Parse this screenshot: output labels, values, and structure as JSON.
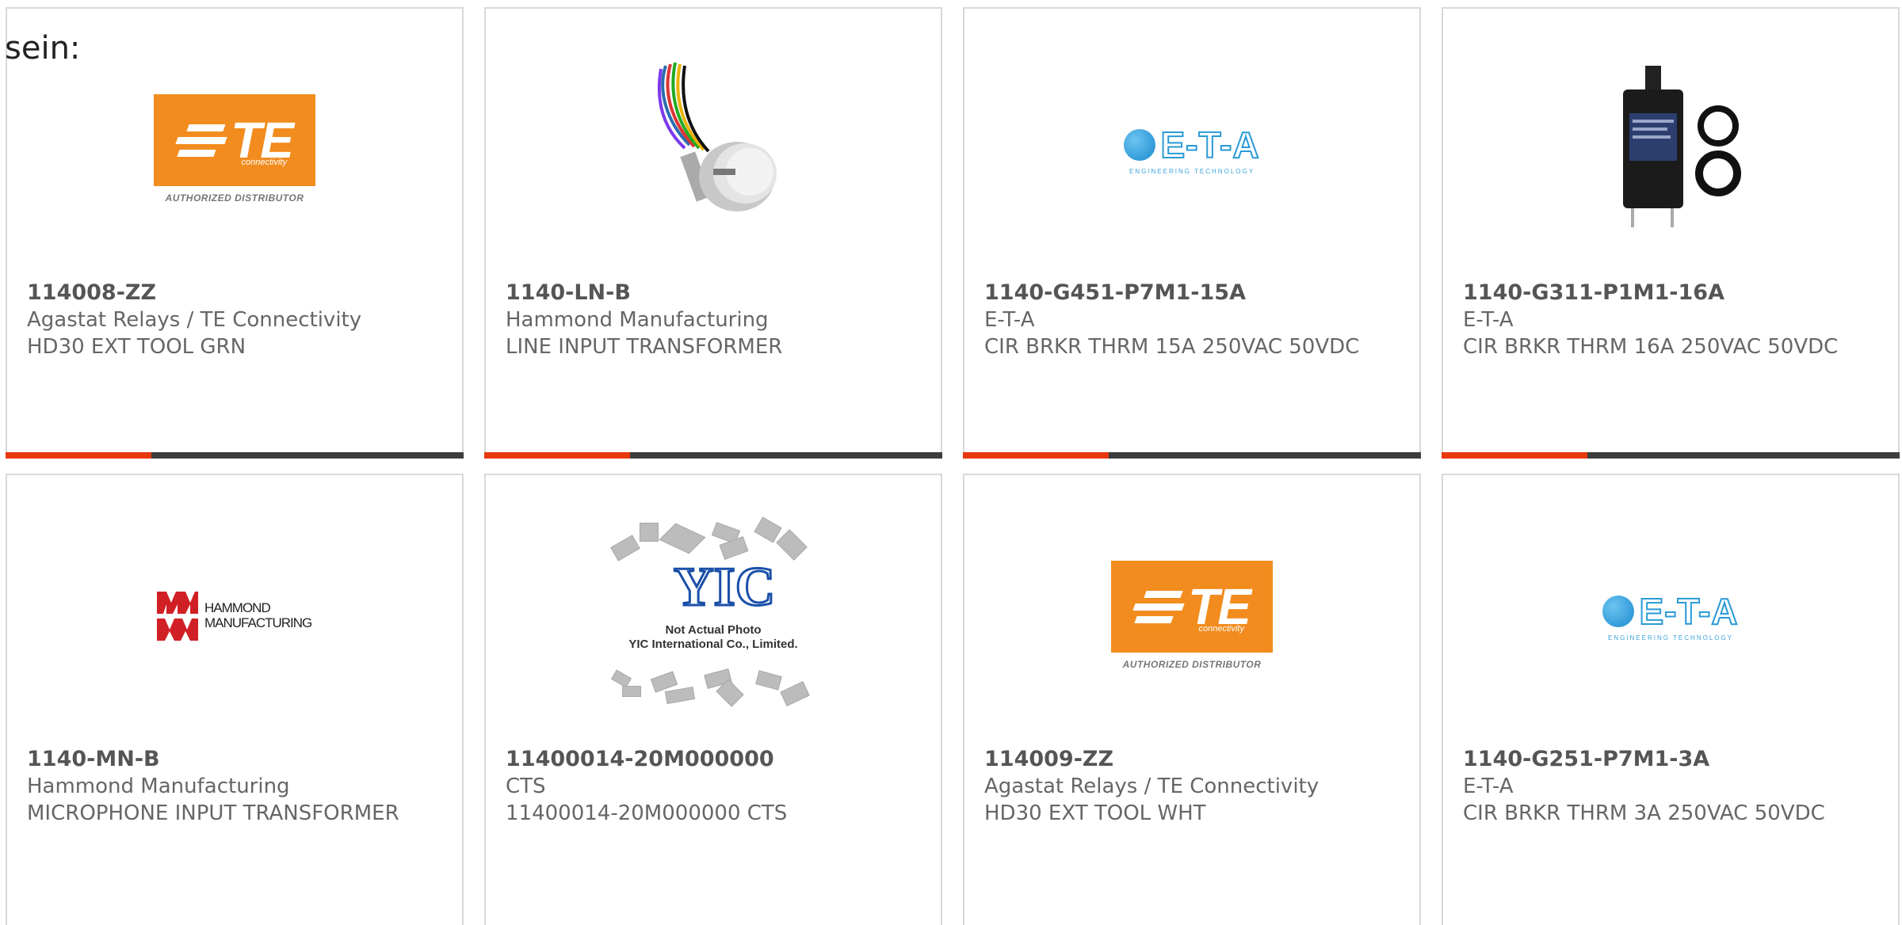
{
  "intro_text": "sein:",
  "logos": {
    "te_wordmark": "TE",
    "te_sub": "connectivity",
    "te_authorized": "AUTHORIZED DISTRIBUTOR",
    "eta_wordmark": "E-T-A",
    "eta_sub": "ENGINEERING TECHNOLOGY",
    "hammond_line1": "HAMMOND",
    "hammond_line2": "MANUFACTURING",
    "yic_mark": "YIC",
    "yic_caption_1": "Not Actual Photo",
    "yic_caption_2": "YIC International Co., Limited."
  },
  "colors": {
    "accent": "#e8380d",
    "bar": "#3d3d3d",
    "te_orange": "#f28c1e",
    "eta_blue": "#2a9ad6",
    "hammond_red": "#d11f26"
  },
  "products": [
    {
      "part_number": "114008-ZZ",
      "manufacturer": "Agastat Relays / TE Connectivity",
      "description": "HD30 EXT TOOL GRN",
      "image": "te-connectivity-logo"
    },
    {
      "part_number": "1140-LN-B",
      "manufacturer": "Hammond Manufacturing",
      "description": "LINE INPUT TRANSFORMER",
      "image": "transformer-photo"
    },
    {
      "part_number": "1140-G451-P7M1-15A",
      "manufacturer": "E-T-A",
      "description": "CIR BRKR THRM 15A 250VAC 50VDC",
      "image": "eta-logo"
    },
    {
      "part_number": "1140-G311-P1M1-16A",
      "manufacturer": "E-T-A",
      "description": "CIR BRKR THRM 16A 250VAC 50VDC",
      "image": "circuit-breaker-photo"
    },
    {
      "part_number": "1140-MN-B",
      "manufacturer": "Hammond Manufacturing",
      "description": "MICROPHONE INPUT TRANSFORMER",
      "image": "hammond-logo"
    },
    {
      "part_number": "11400014-20M000000",
      "manufacturer": "CTS",
      "description": "11400014-20M000000 CTS",
      "image": "yic-placeholder"
    },
    {
      "part_number": "114009-ZZ",
      "manufacturer": "Agastat Relays / TE Connectivity",
      "description": "HD30 EXT TOOL WHT",
      "image": "te-connectivity-logo"
    },
    {
      "part_number": "1140-G251-P7M1-3A",
      "manufacturer": "E-T-A",
      "description": "CIR BRKR THRM 3A 250VAC 50VDC",
      "image": "eta-logo"
    }
  ]
}
